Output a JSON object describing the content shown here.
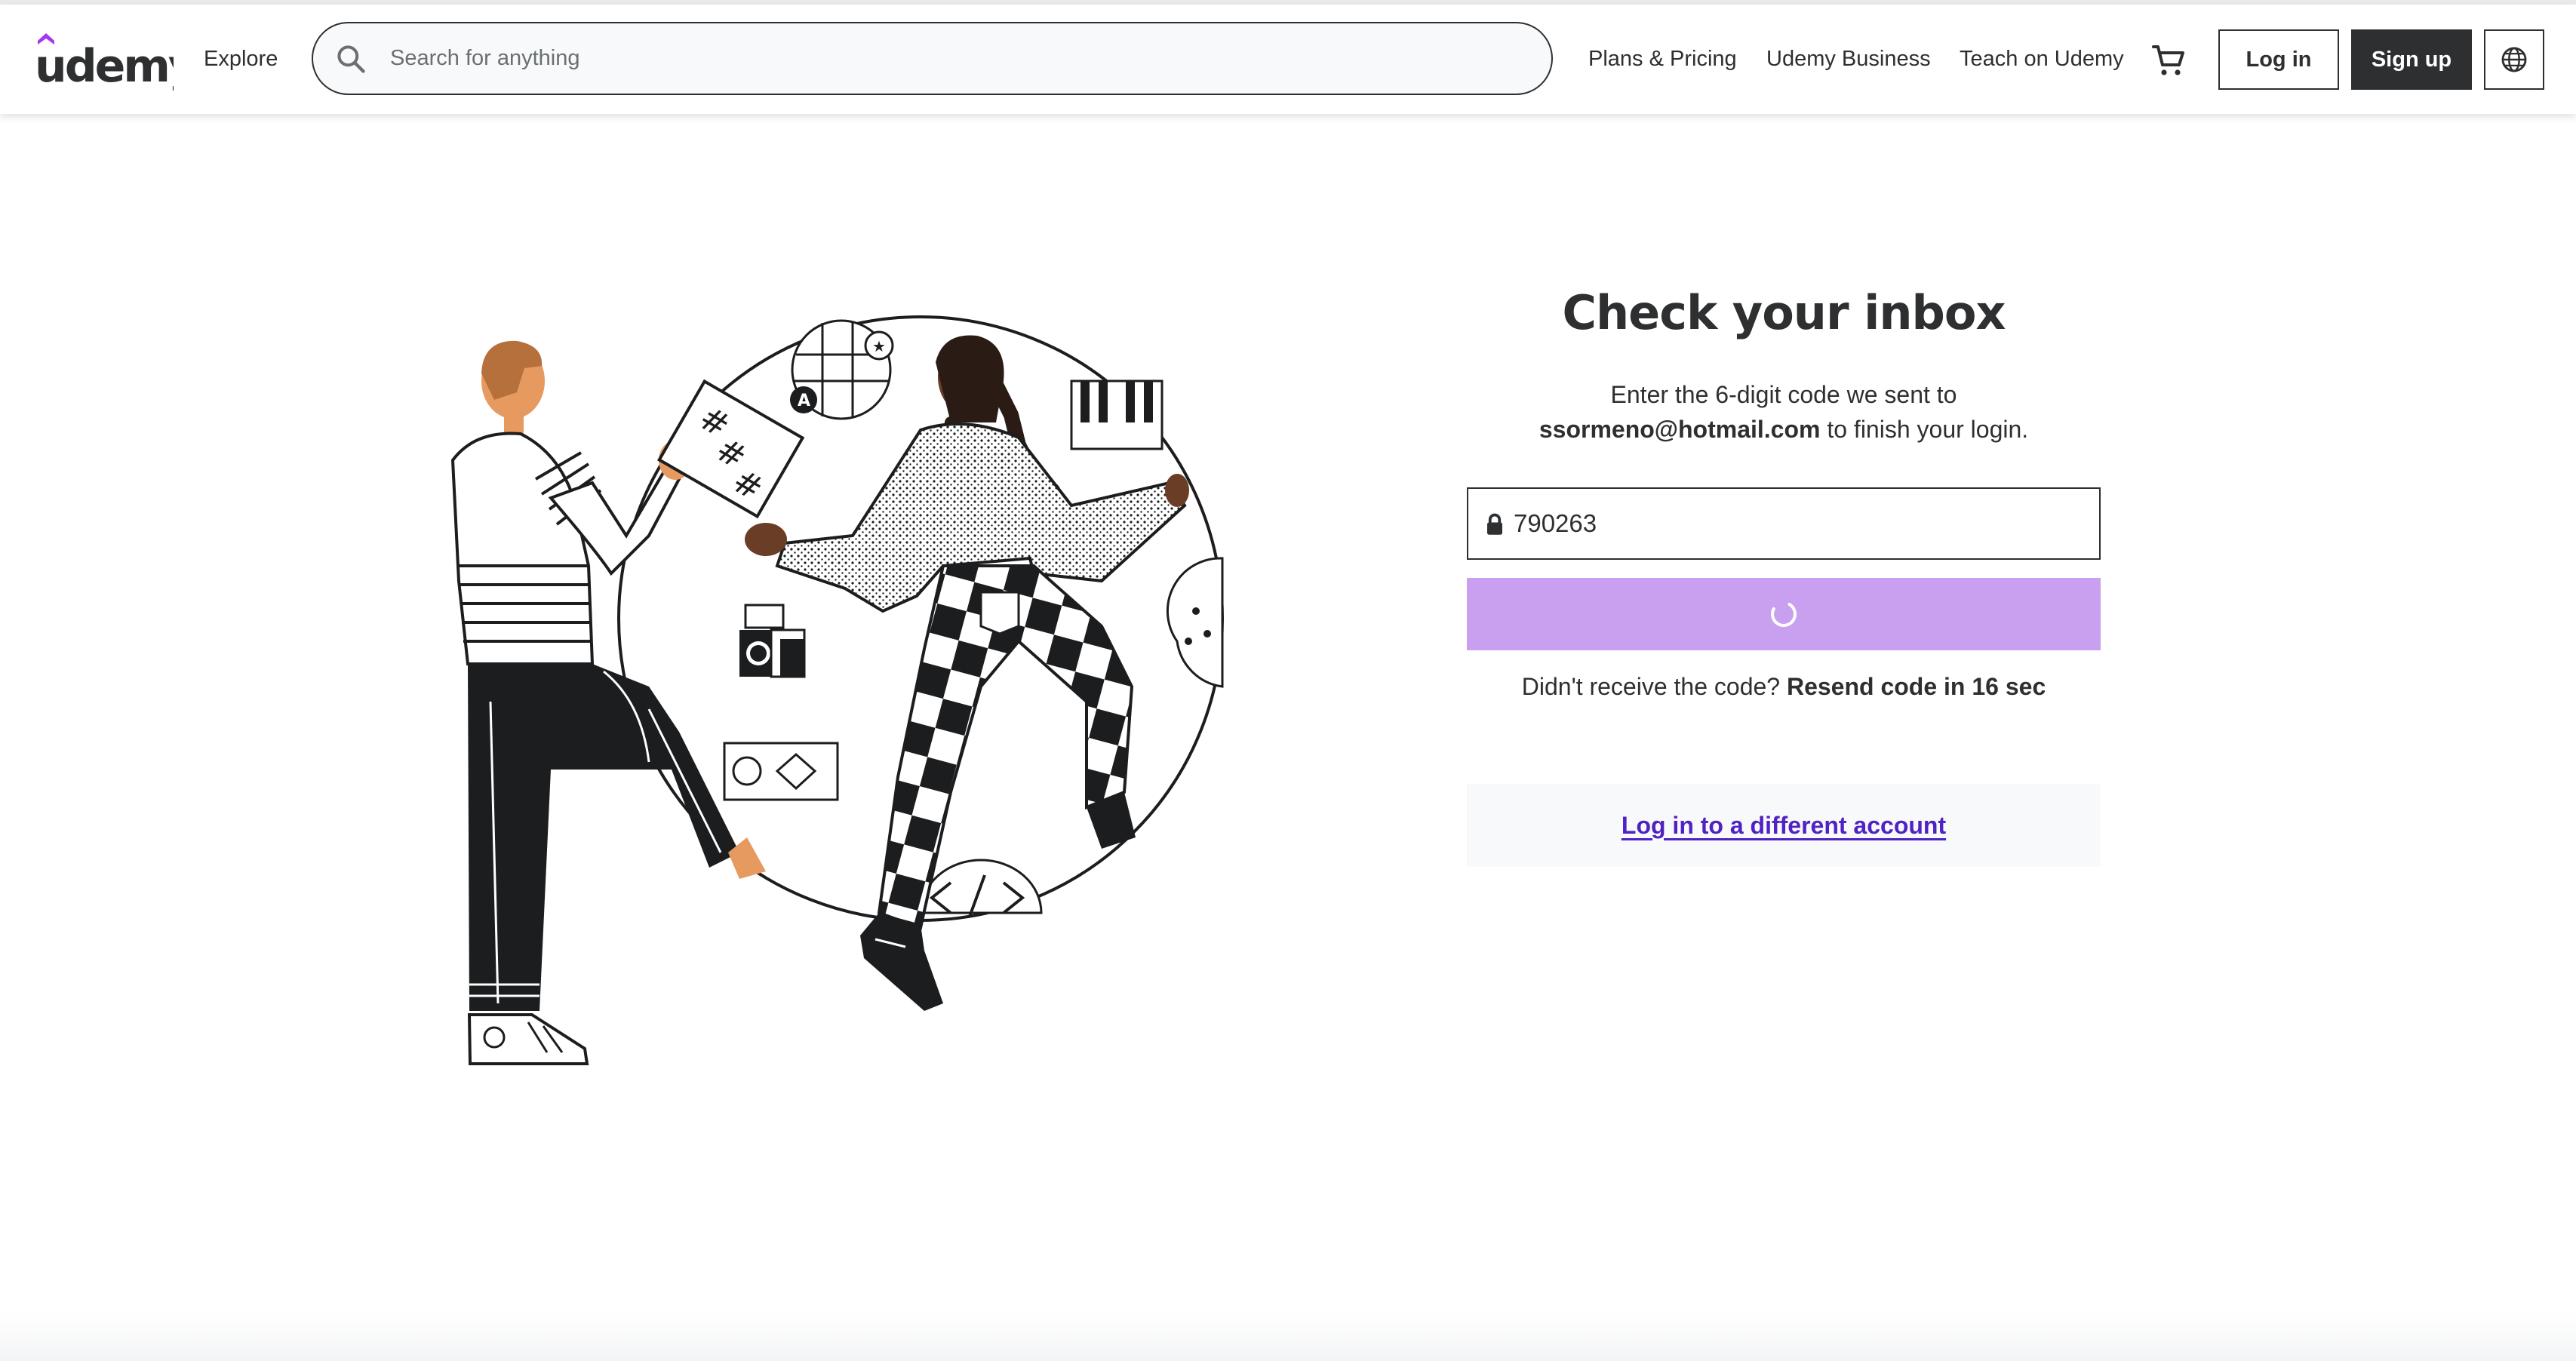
{
  "header": {
    "logo_text": "ūdemy",
    "explore_label": "Explore",
    "search_placeholder": "Search for anything",
    "links": [
      "Plans & Pricing",
      "Udemy Business",
      "Teach on Udemy"
    ],
    "login_label": "Log in",
    "signup_label": "Sign up",
    "icons": {
      "search": "search-icon",
      "cart": "cart-icon",
      "language": "globe-icon"
    }
  },
  "main": {
    "title": "Check your inbox",
    "instruction_prefix": "Enter the 6-digit code we sent to",
    "email": "ssormeno@hotmail.com",
    "instruction_suffix": "to finish your login.",
    "code_value": "790263",
    "submit_state": "loading",
    "resend_prefix": "Didn't receive the code?",
    "resend_action": "Resend code in 16 sec",
    "alt_login_label": "Log in to a different account"
  },
  "colors": {
    "brand_purple": "#a435f0",
    "submit_disabled": "#c9a0f0",
    "link_purple": "#5022c3",
    "text_dark": "#2d2f31"
  }
}
